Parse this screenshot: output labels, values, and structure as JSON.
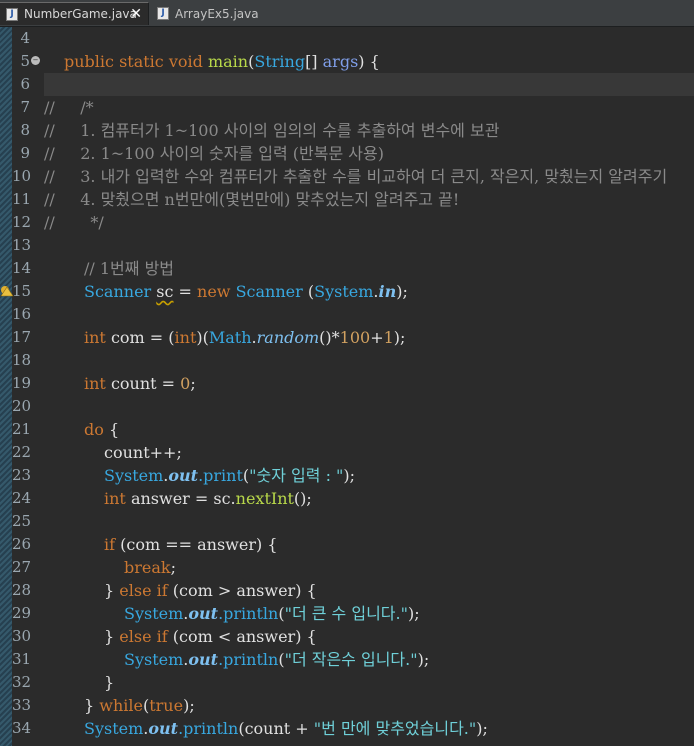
{
  "tabs": [
    {
      "label": "NumberGame.java",
      "active": true,
      "close": "✕"
    },
    {
      "label": "ArrayEx5.java",
      "active": false
    }
  ],
  "line_numbers": [
    "4",
    "5",
    "6",
    "7",
    "8",
    "9",
    "10",
    "11",
    "12",
    "13",
    "14",
    "15",
    "16",
    "17",
    "18",
    "19",
    "20",
    "21",
    "22",
    "23",
    "24",
    "25",
    "26",
    "27",
    "28",
    "29",
    "30",
    "31",
    "32",
    "33",
    "34"
  ],
  "code": {
    "l5": {
      "kw1": "public static void ",
      "fn": "main",
      "p1": "(",
      "ty": "String",
      "p2": "[] ",
      "par": "args",
      "p3": ") {"
    },
    "l7": {
      "pre": "//     ",
      "cm": "/*"
    },
    "l8": {
      "pre": "//     ",
      "cm": "1. 컴퓨터가 1~100 사이의 임의의 수를 추출하여 변수에 보관"
    },
    "l9": {
      "pre": "//     ",
      "cm": "2. 1~100 사이의 숫자를 입력 (반복문 사용)"
    },
    "l10": {
      "pre": "//     ",
      "cm": "3. 내가 입력한 수와 컴퓨터가 추출한 수를 비교하여 더 큰지, 작은지, 맞췄는지 알려주기"
    },
    "l11": {
      "pre": "//     ",
      "cm": "4. 맞췄으면 n번만에(몇번만에) 맞추었는지 알려주고 끝!"
    },
    "l12": {
      "pre": "//       ",
      "cm": "*/"
    },
    "l14": {
      "cm": "// 1번째 방법"
    },
    "l15": {
      "ty1": "Scanner ",
      "var": "sc",
      "eq": " = ",
      "kw": "new ",
      "ty2": "Scanner ",
      "p1": "(",
      "ty3": "System",
      "dot": ".",
      "in": "in",
      "p2": ");"
    },
    "l17": {
      "kw1": "int ",
      "var": "com = (",
      "kw2": "int",
      "p1": ")(",
      "ty": "Math",
      "dot": ".",
      "fn": "random",
      "p2": "()*",
      "n1": "100",
      "plus": "+",
      "n2": "1",
      "p3": ");"
    },
    "l19": {
      "kw": "int ",
      "var": "count = ",
      "n": "0",
      "end": ";"
    },
    "l21": {
      "kw": "do ",
      "rest": "{"
    },
    "l22": {
      "text": "count++;"
    },
    "l23": {
      "ty": "System",
      "dot": ".",
      "out": "out",
      "fn": ".print",
      "p1": "(",
      "st": "\"숫자 입력 : \"",
      "p2": ");"
    },
    "l24": {
      "kw": "int ",
      "var": "answer = sc.",
      "fn": "nextInt",
      "p": "();"
    },
    "l26": {
      "kw": "if ",
      "rest": "(com == answer) {"
    },
    "l27": {
      "kw": "break",
      "end": ";"
    },
    "l28": {
      "a": "} ",
      "kw1": "else if ",
      "rest": "(com > answer) {"
    },
    "l29": {
      "ty": "System",
      "dot": ".",
      "out": "out",
      "fn": ".println",
      "p1": "(",
      "st": "\"더 큰 수 입니다.\"",
      "p2": ");"
    },
    "l30": {
      "a": "} ",
      "kw1": "else if ",
      "rest": "(com < answer) {"
    },
    "l31": {
      "ty": "System",
      "dot": ".",
      "out": "out",
      "fn": ".println",
      "p1": "(",
      "st": "\"더 작은수 입니다.\"",
      "p2": ");"
    },
    "l32": {
      "text": "}"
    },
    "l33": {
      "a": "} ",
      "kw": "while",
      "p1": "(",
      "kw2": "true",
      "p2": ");"
    },
    "l34": {
      "ty": "System",
      "dot": ".",
      "out": "out",
      "fn": ".println",
      "p1": "(count + ",
      "st": "\"번 만에 맞추었습니다.\"",
      "p2": ");"
    }
  }
}
